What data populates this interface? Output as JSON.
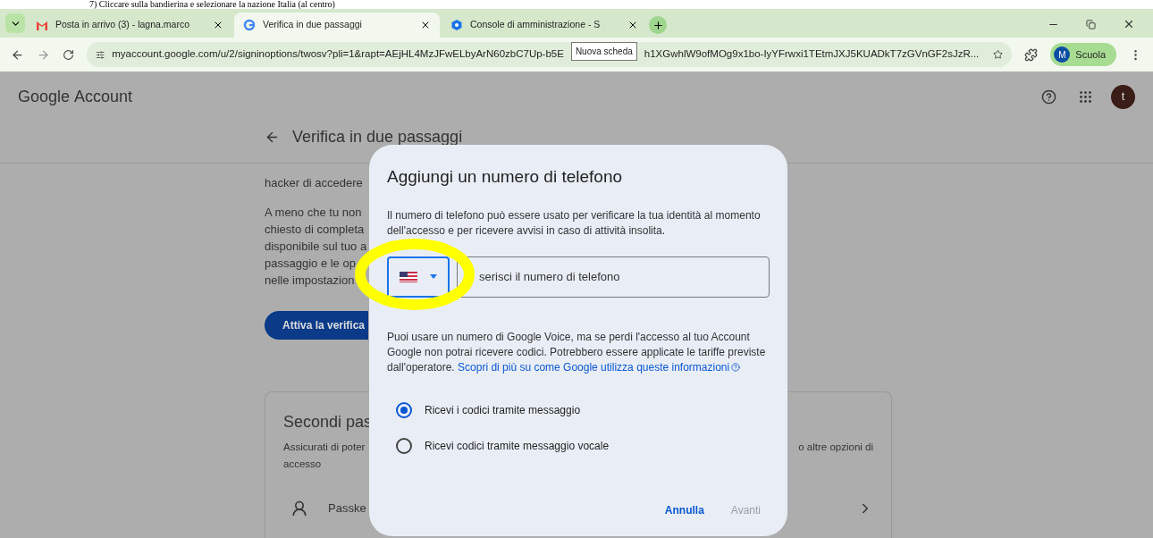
{
  "caption": "7) Cliccare sulla bandierina e selezionare la nazione Italia (al centro)",
  "tabs": [
    {
      "title": "Posta in arrivo (3) - lagna.marco",
      "kind": "mail",
      "selected": false
    },
    {
      "title": "Verifica in due passaggi",
      "kind": "google",
      "selected": true
    },
    {
      "title": "Console di amministrazione - S",
      "kind": "admin",
      "selected": false
    }
  ],
  "tooltip": "Nuova scheda",
  "address": {
    "url_start": "myaccount.google.com/u/2/signinoptions/twosv?pli=1&rapt=AEjHL4MzJFwELbyArN60zbC7Up-b5E",
    "url_end": "h1XGwhlW9ofMOg9x1bo-IyYFrwxi1TEtmJXJ5KUADkT7zGVnGF2sJzR..."
  },
  "profile": {
    "initial": "M",
    "name": "Scuola"
  },
  "header": {
    "logo": "Google",
    "product": "Account",
    "avatar": "t"
  },
  "page": {
    "title": "Verifica in due passaggi",
    "intro_lines": [
      "hacker di accedere",
      "A meno che tu non",
      "chiesto di completa",
      "disponibile sul tuo a",
      "passaggio e le op",
      "nelle impostazion"
    ],
    "button": "Attiva la verifica",
    "card": {
      "title": "Secondi pas",
      "text_left": "Assicurati di poter",
      "text_right": "o altre opzioni di",
      "text_line2": "accesso",
      "item": "Passke"
    }
  },
  "dialog": {
    "title": "Aggiungi un numero di telefono",
    "description": "Il numero di telefono può essere usato per verificare la tua identità al momento dell'accesso e per ricevere avvisi in caso di attività insolita.",
    "phone_placeholder": "serisci il numero di telefono",
    "note": "Puoi usare un numero di Google Voice, ma se perdi l'accesso al tuo Account Google non potrai ricevere codici. Potrebbero essere applicate le tariffe previste dall'operatore.",
    "link": "Scopri di più su come Google utilizza queste informazioni",
    "options": [
      {
        "label": "Ricevi i codici tramite messaggio",
        "selected": true
      },
      {
        "label": "Ricevi codici tramite messaggio vocale",
        "selected": false
      }
    ],
    "actions": [
      {
        "label": "Annulla",
        "disabled": false
      },
      {
        "label": "Avanti",
        "disabled": true
      }
    ]
  }
}
